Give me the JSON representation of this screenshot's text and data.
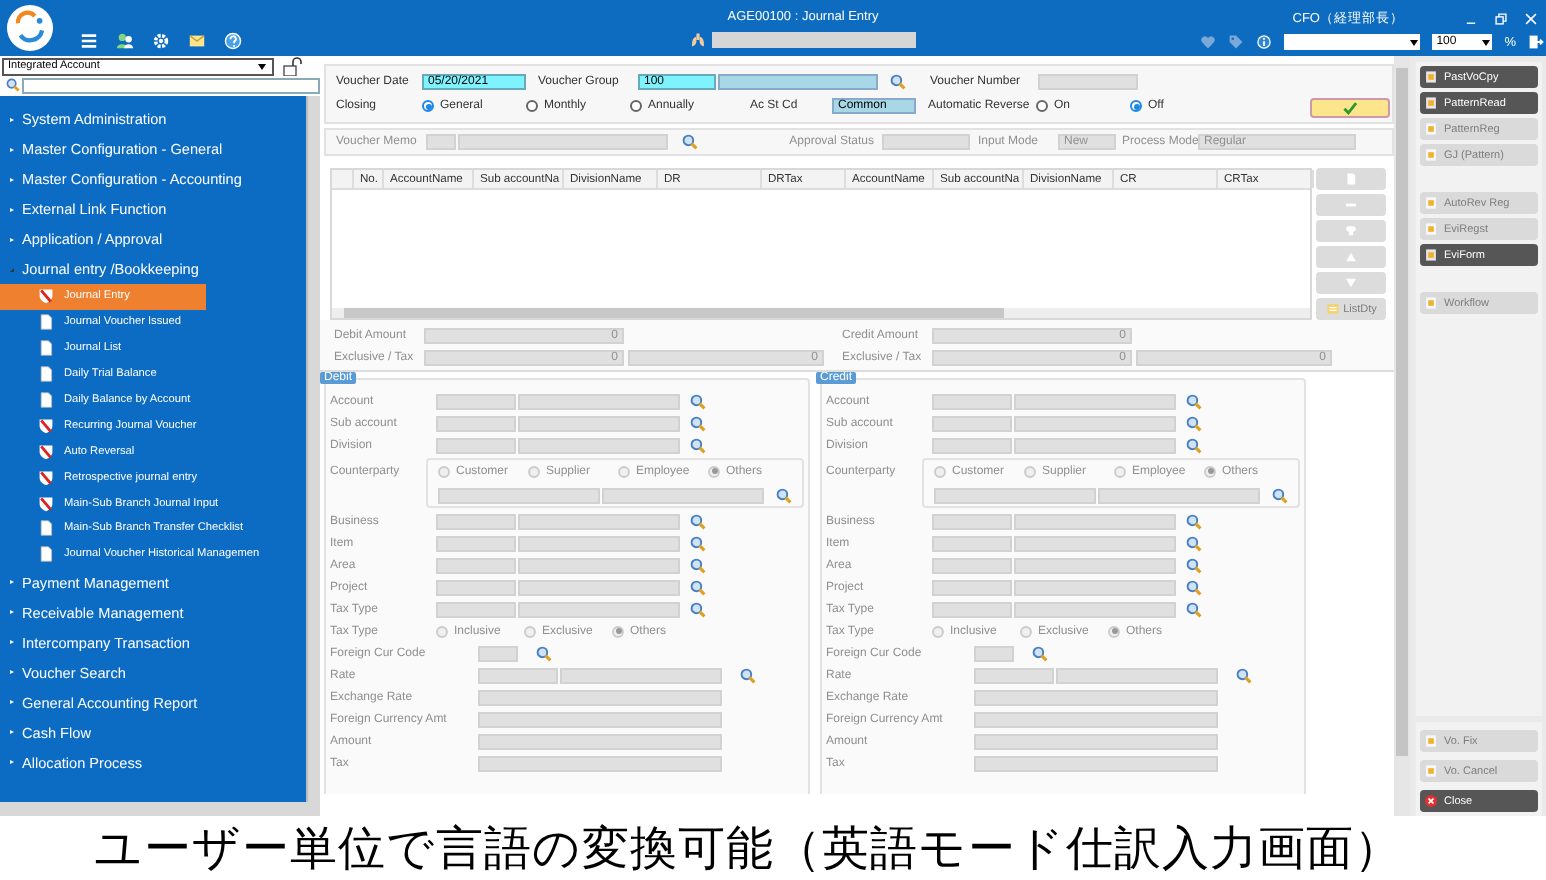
{
  "top_bar": {
    "title": "AGE00100 : Journal Entry",
    "user": "CFO（経理部長）",
    "zoom": "100",
    "zoom_unit": "%"
  },
  "sidebar": {
    "account": "Integrated Account",
    "menu": [
      {
        "label": "System Administration",
        "expanded": false
      },
      {
        "label": "Master Configuration - General",
        "expanded": false
      },
      {
        "label": "Master Configuration - Accounting",
        "expanded": false
      },
      {
        "label": "External Link Function",
        "expanded": false
      },
      {
        "label": "Application / Approval",
        "expanded": false
      },
      {
        "label": "Journal entry /Bookkeeping",
        "expanded": true,
        "children": [
          {
            "label": "Journal Entry",
            "kind": "entry",
            "selected": true
          },
          {
            "label": "Journal Voucher Issued",
            "kind": "report",
            "selected": false
          },
          {
            "label": "Journal List",
            "kind": "report",
            "selected": false
          },
          {
            "label": "Daily Trial Balance",
            "kind": "report",
            "selected": false
          },
          {
            "label": "Daily Balance by Account",
            "kind": "report",
            "selected": false
          },
          {
            "label": "Recurring Journal Voucher",
            "kind": "entry",
            "selected": false
          },
          {
            "label": "Auto Reversal",
            "kind": "entry",
            "selected": false
          },
          {
            "label": "Retrospective journal entry",
            "kind": "entry",
            "selected": false
          },
          {
            "label": "Main-Sub Branch Journal Input",
            "kind": "entry",
            "selected": false
          },
          {
            "label": "Main-Sub Branch Transfer Checklist",
            "kind": "report",
            "selected": false
          },
          {
            "label": "Journal Voucher Historical Managemen",
            "kind": "report",
            "selected": false
          }
        ]
      },
      {
        "label": "Payment Management",
        "expanded": false
      },
      {
        "label": "Receivable Management",
        "expanded": false
      },
      {
        "label": "Intercompany Transaction",
        "expanded": false
      },
      {
        "label": "Voucher Search",
        "expanded": false
      },
      {
        "label": "General Accounting Report",
        "expanded": false
      },
      {
        "label": "Cash Flow",
        "expanded": false
      },
      {
        "label": "Allocation Process",
        "expanded": false
      }
    ]
  },
  "header": {
    "voucher_date": {
      "label": "Voucher Date",
      "value": "05/20/2021"
    },
    "voucher_group": {
      "label": "Voucher Group",
      "value": "100"
    },
    "voucher_number": {
      "label": "Voucher Number"
    },
    "closing": {
      "label": "Closing",
      "options": [
        {
          "label": "General",
          "selected": true
        },
        {
          "label": "Monthly",
          "selected": false
        },
        {
          "label": "Annually",
          "selected": false
        }
      ]
    },
    "ac_st_cd": {
      "label": "Ac St Cd",
      "value": "Common"
    },
    "automatic_reverse": {
      "label": "Automatic Reverse",
      "options": [
        {
          "label": "On",
          "selected": false
        },
        {
          "label": "Off",
          "selected": true
        }
      ]
    }
  },
  "memo_row": {
    "disabled": true,
    "voucher_memo": {
      "label": "Voucher Memo"
    },
    "approval_status": {
      "label": "Approval Status"
    },
    "input_mode": {
      "label": "Input Mode",
      "value": "New"
    },
    "process_mode": {
      "label": "Process Mode",
      "value": "Regular"
    }
  },
  "grid": {
    "columns": [
      "No.",
      "AccountName",
      "Sub accountNa",
      "DivisionName",
      "DR",
      "DRTax",
      "AccountName",
      "Sub accountNa",
      "DivisionName",
      "CR",
      "CRTax"
    ],
    "tools": [
      {
        "kind": "add",
        "disabled": true
      },
      {
        "kind": "remove",
        "disabled": true
      },
      {
        "kind": "insert",
        "disabled": true
      },
      {
        "kind": "up",
        "disabled": true
      },
      {
        "kind": "down",
        "disabled": true
      },
      {
        "kind": "list",
        "label": "ListDty",
        "disabled": true
      }
    ]
  },
  "totals": [
    {
      "rows": [
        {
          "label": "Debit Amount",
          "values": [
            "0"
          ]
        },
        {
          "label": "Exclusive / Tax",
          "values": [
            "0",
            "0"
          ]
        }
      ]
    },
    {
      "rows": [
        {
          "label": "Credit Amount",
          "values": [
            "0"
          ]
        },
        {
          "label": "Exclusive / Tax",
          "values": [
            "0",
            "0"
          ]
        }
      ]
    }
  ],
  "panels": [
    {
      "title": "Debit",
      "disabled": true,
      "rows": [
        {
          "label": "Account",
          "kind": "pair"
        },
        {
          "label": "Sub account",
          "kind": "pair"
        },
        {
          "label": "Division",
          "kind": "pair"
        },
        {
          "label": "Counterparty",
          "kind": "counterparty",
          "options": [
            {
              "label": "Customer",
              "selected": false
            },
            {
              "label": "Supplier",
              "selected": false
            },
            {
              "label": "Employee",
              "selected": false
            },
            {
              "label": "Others",
              "selected": true
            }
          ]
        },
        {
          "label": "Business",
          "kind": "pair"
        },
        {
          "label": "Item",
          "kind": "pair"
        },
        {
          "label": "Area",
          "kind": "pair"
        },
        {
          "label": "Project",
          "kind": "pair"
        },
        {
          "label": "Tax Type",
          "kind": "pair"
        },
        {
          "label": "Tax Type",
          "kind": "radio",
          "options": [
            {
              "label": "Inclusive",
              "selected": false
            },
            {
              "label": "Exclusive",
              "selected": false
            },
            {
              "label": "Others",
              "selected": true
            }
          ]
        },
        {
          "label": "Foreign Cur Code",
          "kind": "code"
        },
        {
          "label": "Rate",
          "kind": "rate"
        },
        {
          "label": "Exchange Rate",
          "kind": "amount"
        },
        {
          "label": "Foreign Currency Amt",
          "kind": "amount"
        },
        {
          "label": "Amount",
          "kind": "amount"
        },
        {
          "label": "Tax",
          "kind": "amount"
        }
      ]
    },
    {
      "title": "Credit",
      "disabled": true,
      "rows": [
        {
          "label": "Account",
          "kind": "pair"
        },
        {
          "label": "Sub account",
          "kind": "pair"
        },
        {
          "label": "Division",
          "kind": "pair"
        },
        {
          "label": "Counterparty",
          "kind": "counterparty",
          "options": [
            {
              "label": "Customer",
              "selected": false
            },
            {
              "label": "Supplier",
              "selected": false
            },
            {
              "label": "Employee",
              "selected": false
            },
            {
              "label": "Others",
              "selected": true
            }
          ]
        },
        {
          "label": "Business",
          "kind": "pair"
        },
        {
          "label": "Item",
          "kind": "pair"
        },
        {
          "label": "Area",
          "kind": "pair"
        },
        {
          "label": "Project",
          "kind": "pair"
        },
        {
          "label": "Tax Type",
          "kind": "pair"
        },
        {
          "label": "Tax Type",
          "kind": "radio",
          "options": [
            {
              "label": "Inclusive",
              "selected": false
            },
            {
              "label": "Exclusive",
              "selected": false
            },
            {
              "label": "Others",
              "selected": true
            }
          ]
        },
        {
          "label": "Foreign Cur Code",
          "kind": "code"
        },
        {
          "label": "Rate",
          "kind": "rate"
        },
        {
          "label": "Exchange Rate",
          "kind": "amount"
        },
        {
          "label": "Foreign Currency Amt",
          "kind": "amount"
        },
        {
          "label": "Amount",
          "kind": "amount"
        },
        {
          "label": "Tax",
          "kind": "amount"
        }
      ]
    }
  ],
  "actions": {
    "groups": [
      [
        {
          "label": "PastVoCpy",
          "kind": "document",
          "disabled": false
        },
        {
          "label": "PatternRead",
          "kind": "document",
          "disabled": false
        },
        {
          "label": "PatternReg",
          "kind": "document",
          "disabled": true
        },
        {
          "label": "GJ (Pattern)",
          "kind": "document",
          "disabled": true
        }
      ],
      [
        {
          "label": "AutoRev Reg",
          "kind": "document",
          "disabled": true
        },
        {
          "label": "EviRegst",
          "kind": "document",
          "disabled": true
        },
        {
          "label": "EviForm",
          "kind": "document",
          "disabled": false
        }
      ],
      [
        {
          "label": "Workflow",
          "kind": "document",
          "disabled": true
        }
      ]
    ],
    "bottom": [
      {
        "label": "Vo. Fix",
        "kind": "document",
        "disabled": true
      },
      {
        "label": "Vo. Cancel",
        "kind": "document",
        "disabled": true
      },
      {
        "label": "Close",
        "kind": "close",
        "disabled": false
      }
    ]
  },
  "caption": "ユーザー単位で言語の変換可能（英語モード仕訳入力画面）"
}
